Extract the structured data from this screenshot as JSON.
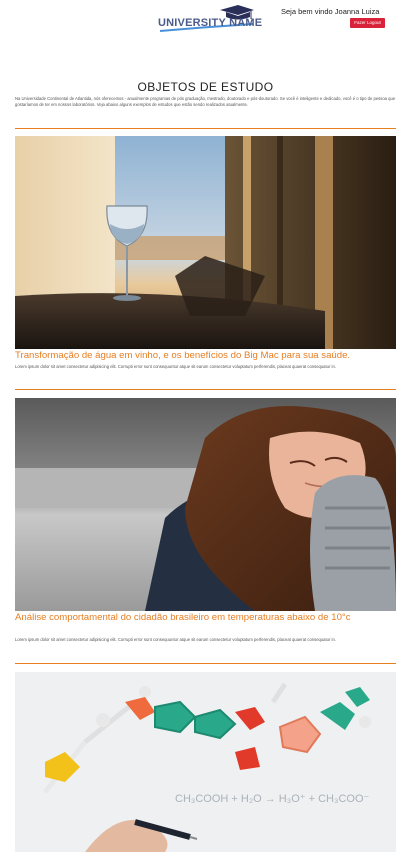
{
  "header": {
    "logo_text": "UNIVERSITY NAME",
    "welcome": "Seja bem vindo Joanna Luiza",
    "logout_label": "Fazer Logout"
  },
  "page": {
    "title": "OBJETOS DE ESTUDO",
    "intro": "Na Universidade Continental de Atlantida, nós oferecemos - anualmente programas de pós graduação, mestrado, doutorado e pós-doutorado. Se você é inteligente e dedicado, você é o tipo de pessoa que gostaríamos de ter em nossos laboratórios. Veja abaixo alguns exemplos de estudos que estão sendo realizados atualmente."
  },
  "articles": [
    {
      "title": "Transformação de água em vinho, e os benefícios do Big Mac para sua saúde.",
      "text": "Lorem ipsum dolor sit amet consectetur adipisicing elit. Corrupti error sunt consequuntur atque sit earum consectetur voluptatum perferendis, placeat quaerat consequatur in."
    },
    {
      "title": "Análise comportamental do cidadão brasileiro em temperaturas abaixo de 10°c",
      "text": "Lorem ipsum dolor sit amet consectetur adipisicing elit. Corrupti error sunt consequuntur atque sit earum consectetur voluptatum perferendis, placeat quaerat consequatur in."
    }
  ],
  "colors": {
    "accent": "#e67e22",
    "logout": "#d9223a"
  }
}
